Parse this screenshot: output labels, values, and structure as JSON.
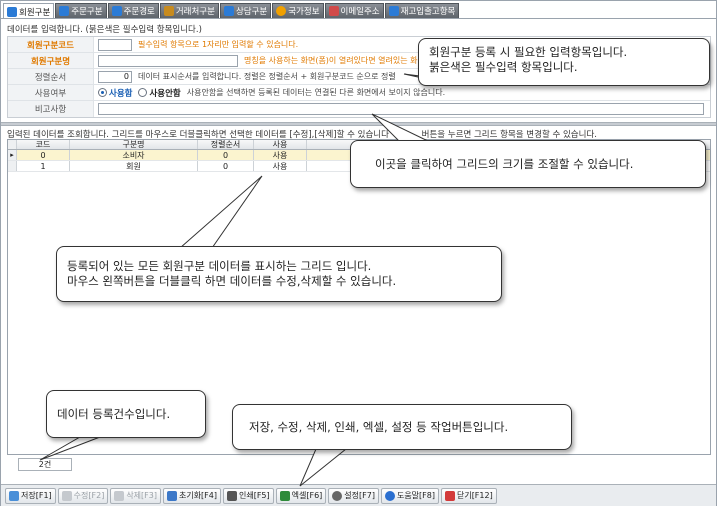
{
  "tabs": [
    {
      "label": "회원구분",
      "icon": "member-icon",
      "color": "#2b7bd6",
      "active": true
    },
    {
      "label": "주문구분",
      "icon": "order-icon",
      "color": "#2b7bd6"
    },
    {
      "label": "주문경로",
      "icon": "route-icon",
      "color": "#2b7bd6"
    },
    {
      "label": "거래처구분",
      "icon": "client-icon",
      "color": "#c78b1f"
    },
    {
      "label": "상담구분",
      "icon": "consult-icon",
      "color": "#2b7bd6"
    },
    {
      "label": "국가정보",
      "icon": "sun-icon",
      "color": "#f0a000"
    },
    {
      "label": "이메일주소",
      "icon": "mail-icon",
      "color": "#d14a4a"
    },
    {
      "label": "재고입출고항목",
      "icon": "stock-icon",
      "color": "#2b7bd6"
    }
  ],
  "form_hint": "데이터를 입력합니다. (붉은색은 필수입력 항목입니다.)",
  "form": {
    "code_label": "회원구분코드",
    "code_value": "",
    "code_note": "필수입력 항목으로 1자리만 입력할 수 있습니다.",
    "name_label": "회원구분명",
    "name_value": "",
    "name_note": "명칭을 사용하는 화면(폼)이 열려있다면 열려있는 화면을 닫",
    "sort_label": "정렬순서",
    "sort_value": "0",
    "sort_note": "데이터 표시순서를 입력합니다. 정렬은 정렬순서 + 회원구분코드 순으로 정렬",
    "use_label": "사용여부",
    "use_on": "사용함",
    "use_off": "사용안함",
    "use_note": "사용안함을 선택하면 등록된 데이터는 연결된 다른 화면에서 보이지 않습니다.",
    "memo_label": "비고사항",
    "memo_value": ""
  },
  "grid_hint": "입력된 데이터를 조회합니다. 그리드를 마우스로 더블클릭하면 선택한 데이터를 [수정],[삭제]할 수 있습니다",
  "grid_hint_tail": "버튼을 누르면 그리드 항목을 변경할 수 있습니다.",
  "grid": {
    "columns": [
      "코드",
      "구분명",
      "정렬순서",
      "사용"
    ],
    "rows": [
      {
        "code": "0",
        "name": "소비자",
        "sort": "0",
        "use": "사용"
      },
      {
        "code": "1",
        "name": "회원",
        "sort": "0",
        "use": "사용"
      }
    ]
  },
  "record_count": "2건",
  "toolbar": [
    {
      "label": "저장[F1]",
      "icon": "save-icon",
      "color": "#4a8fd8",
      "enabled": true
    },
    {
      "label": "수정[F2]",
      "icon": "edit-icon",
      "color": "#9aa0a6",
      "enabled": false
    },
    {
      "label": "삭제[F3]",
      "icon": "delete-icon",
      "color": "#9aa0a6",
      "enabled": false
    },
    {
      "label": "초기화[F4]",
      "icon": "reset-icon",
      "color": "#3c78c8",
      "enabled": true
    },
    {
      "label": "인쇄[F5]",
      "icon": "print-icon",
      "color": "#555555",
      "enabled": true
    },
    {
      "label": "엑셀[F6]",
      "icon": "excel-icon",
      "color": "#2e8b3a",
      "enabled": true
    },
    {
      "label": "설정[F7]",
      "icon": "gear-icon",
      "color": "#666666",
      "enabled": true
    },
    {
      "label": "도움말[F8]",
      "icon": "help-icon",
      "color": "#2b6fd0",
      "enabled": true
    },
    {
      "label": "닫기[F12]",
      "icon": "close-icon",
      "color": "#d33a3a",
      "enabled": true
    }
  ],
  "callouts": {
    "form_line1": "회원구분 등록 시 필요한 입력항목입니다.",
    "form_line2": "붉은색은 필수입력 항목입니다.",
    "splitter": "이곳을 클릭하여 그리드의 크기를 조절할 수 있습니다.",
    "grid_line1": "등록되어 있는 모든 회원구분 데이터를 표시하는 그리드 입니다.",
    "grid_line2": "마우스 왼쪽버튼을 더블클릭 하면 데이터를 수정,삭제할 수 있습니다.",
    "count": "데이터 등록건수입니다.",
    "toolbar": "저장, 수정, 삭제, 인쇄, 엑셀, 설정 등 작업버튼입니다."
  }
}
